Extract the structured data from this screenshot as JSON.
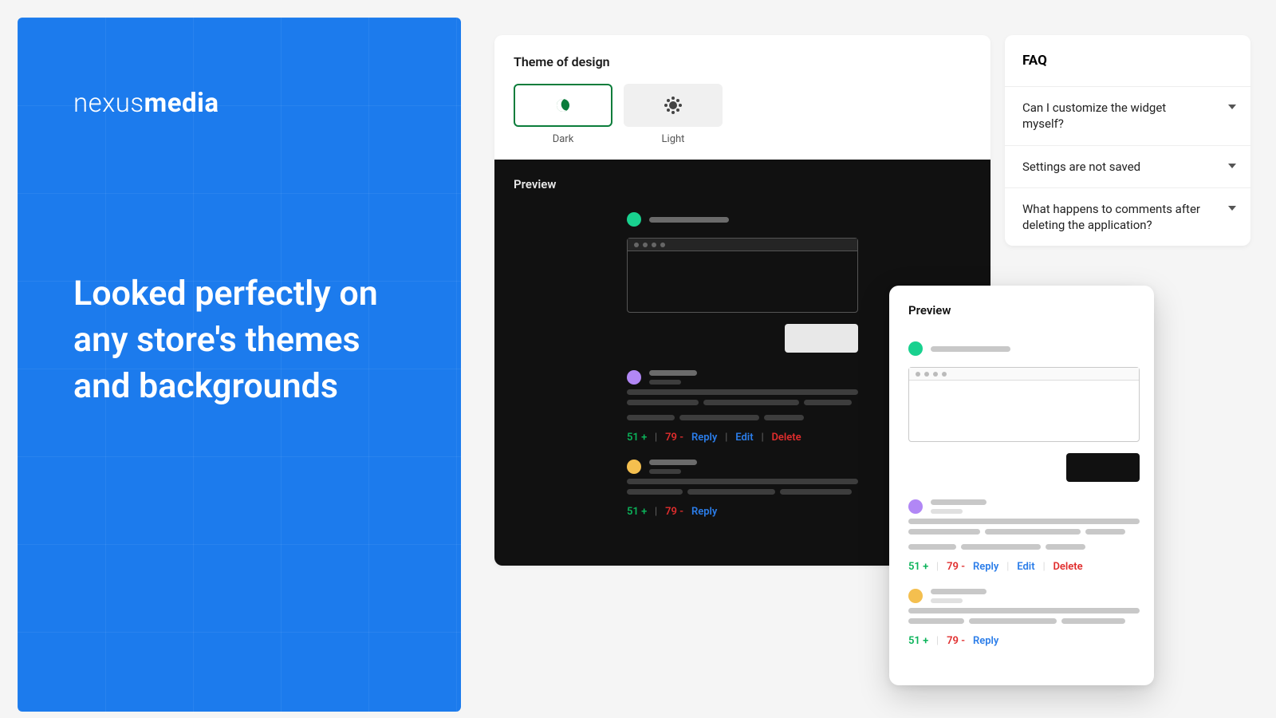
{
  "banner": {
    "brand_light": "nexus",
    "brand_bold": "media",
    "headline": "Looked perfectly on any store's themes and backgrounds"
  },
  "theme": {
    "title": "Theme of design",
    "dark_label": "Dark",
    "light_label": "Light"
  },
  "preview": {
    "title": "Preview"
  },
  "actions": {
    "up_count": "51 +",
    "down_count": "79 -",
    "reply": "Reply",
    "edit": "Edit",
    "delete": "Delete"
  },
  "faq": {
    "title": "FAQ",
    "items": [
      "Can I customize the widget myself?",
      "Settings are not saved",
      "What happens to comments after deleting the application?"
    ]
  }
}
